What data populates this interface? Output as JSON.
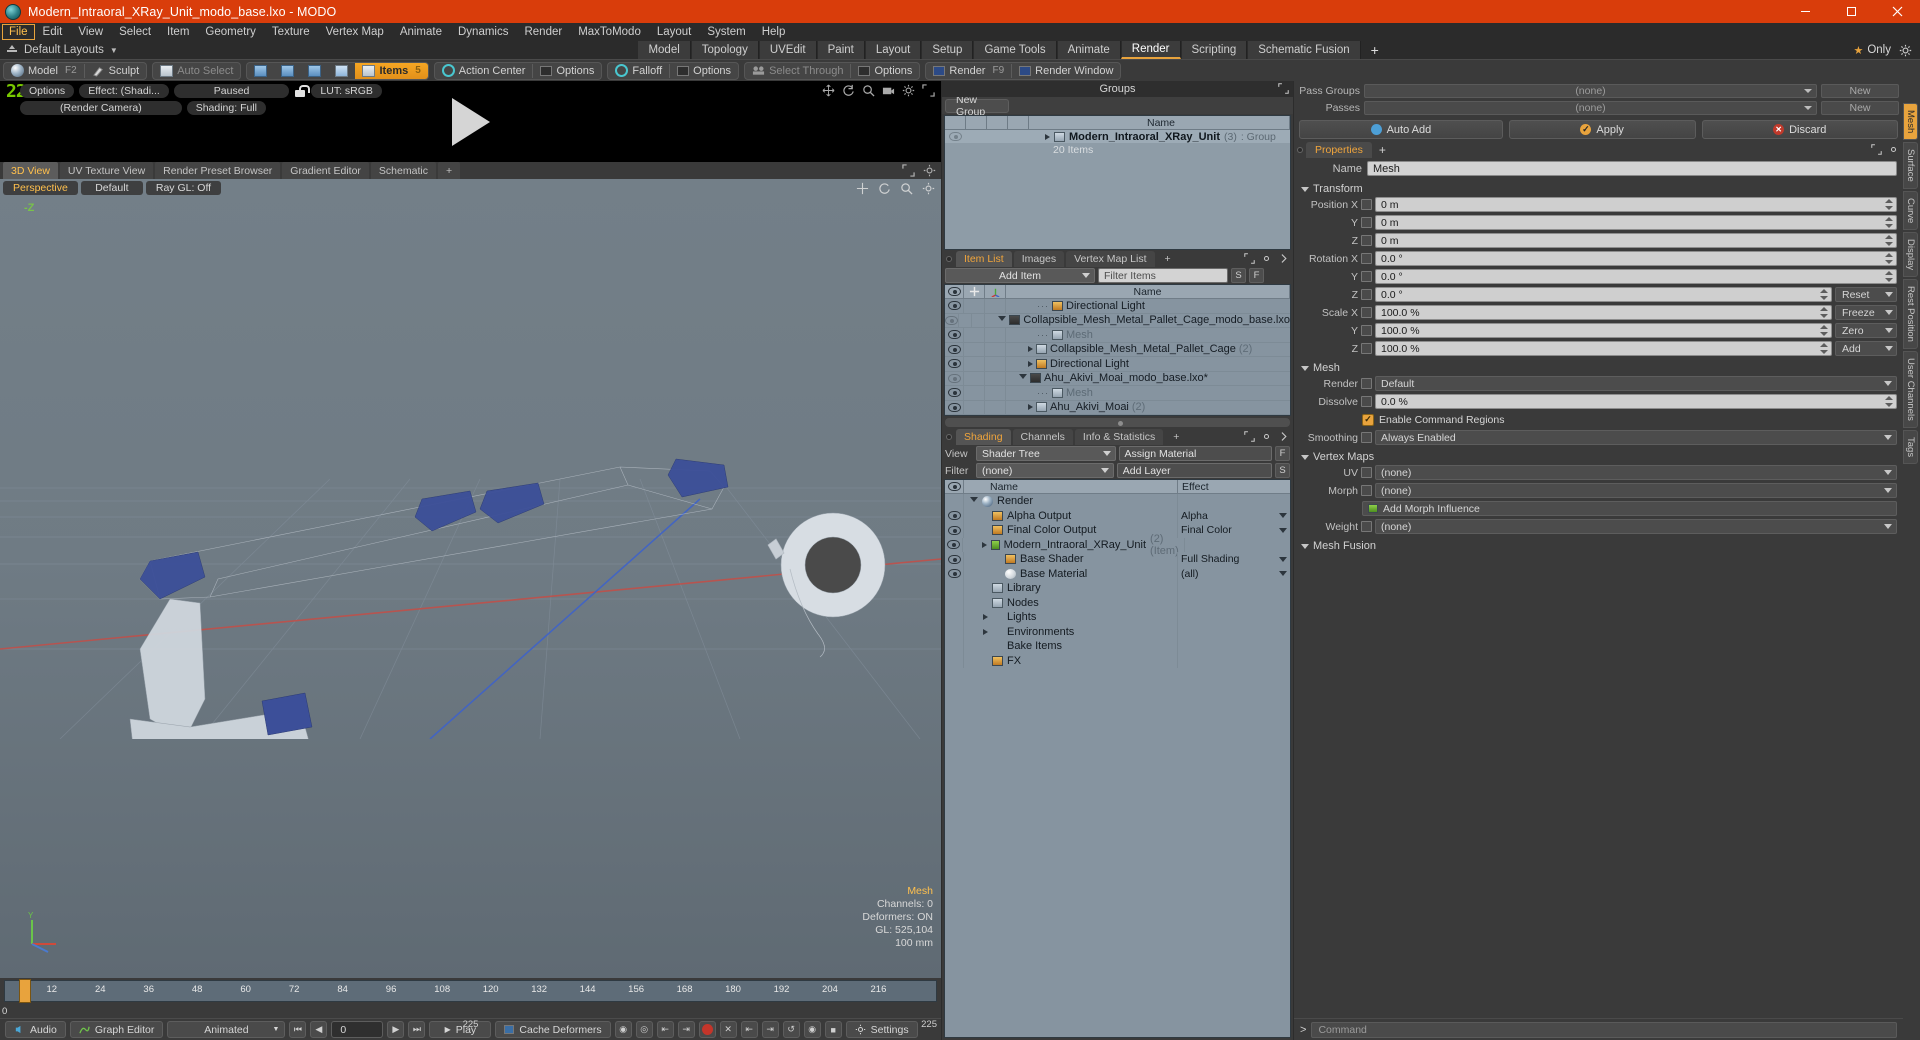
{
  "window": {
    "title": "Modern_Intraoral_XRay_Unit_modo_base.lxo - MODO",
    "minimize": "–",
    "maximize": "❐",
    "close": "✕"
  },
  "menus": [
    "File",
    "Edit",
    "View",
    "Select",
    "Item",
    "Geometry",
    "Texture",
    "Vertex Map",
    "Animate",
    "Dynamics",
    "Render",
    "MaxToModo",
    "Layout",
    "System",
    "Help"
  ],
  "active_menu": "File",
  "layout_bar": {
    "layouts_label": "Default Layouts",
    "tabs": [
      "Model",
      "Topology",
      "UVEdit",
      "Paint",
      "Layout",
      "Setup",
      "Game Tools",
      "Animate",
      "Render",
      "Scripting",
      "Schematic Fusion"
    ],
    "selected_tab": "Render",
    "plus": "+",
    "only_label": "Only",
    "star": "★"
  },
  "mode_toolbar": {
    "model": "Model",
    "model_key": "F2",
    "sculpt": "Sculpt",
    "auto_select": "Auto Select",
    "items": "Items",
    "items_key": "5",
    "action_center": "Action Center",
    "options1": "Options",
    "falloff": "Falloff",
    "options2": "Options",
    "select_through": "Select Through",
    "options3": "Options",
    "render": "Render",
    "render_key": "F9",
    "render_window": "Render Window"
  },
  "render_preview": {
    "badge": "22",
    "options": "Options",
    "effect": "Effect: (Shadi...",
    "status": "Paused",
    "lut": "LUT: sRGB",
    "camera": "(Render Camera)",
    "shading": "Shading: Full"
  },
  "viewport_tabs": {
    "tabs": [
      "3D View",
      "UV Texture View",
      "Render Preset Browser",
      "Gradient Editor",
      "Schematic"
    ],
    "selected": "3D View",
    "plus": "+"
  },
  "viewport": {
    "projection": "Perspective",
    "style": "Default",
    "raygl": "Ray GL: Off",
    "axis_label": "-Z",
    "stats": {
      "title": "Mesh",
      "channels": "Channels: 0",
      "deformers": "Deformers: ON",
      "gl": "GL: 525,104",
      "scale": "100 mm"
    }
  },
  "timeline": {
    "ticks": [
      "12",
      "24",
      "36",
      "48",
      "60",
      "72",
      "84",
      "96",
      "108",
      "120",
      "132",
      "144",
      "156",
      "168",
      "180",
      "192",
      "204",
      "216"
    ],
    "start": "0",
    "center": "225",
    "end": "225"
  },
  "bottom_bar": {
    "audio": "Audio",
    "graph_editor": "Graph Editor",
    "animated": "Animated",
    "frame": "0",
    "play": "Play",
    "cache_deformers": "Cache Deformers",
    "settings": "Settings"
  },
  "groups_panel": {
    "title": "Groups",
    "new_group": "New Group",
    "columns": [
      "Name"
    ],
    "rows": [
      {
        "name": "Modern_Intraoral_XRay_Unit",
        "count": "(3)",
        "type": ": Group",
        "sub": "20 Items"
      }
    ]
  },
  "item_list": {
    "tabs": [
      "Item List",
      "Images",
      "Vertex Map List"
    ],
    "selected_tab": "Item List",
    "plus": "+",
    "add_item": "Add Item",
    "filter_placeholder": "Filter Items",
    "btn_s": "S",
    "btn_f": "F",
    "columns": [
      "Name"
    ],
    "rows": [
      {
        "name": "Directional Light",
        "suffix": "",
        "indent": 3,
        "icon": "light-icon",
        "expander": "",
        "visible": true,
        "gray": false
      },
      {
        "name": "Collapsible_Mesh_Metal_Pallet_Cage_modo_base.lxo",
        "suffix": "",
        "indent": 1,
        "icon": "scene-icon",
        "expander": "down",
        "visible": false,
        "gray": false
      },
      {
        "name": "Mesh",
        "suffix": "",
        "indent": 3,
        "icon": "mesh-icon",
        "expander": "",
        "visible": true,
        "gray": true
      },
      {
        "name": "Collapsible_Mesh_Metal_Pallet_Cage",
        "suffix": "(2)",
        "indent": 2,
        "icon": "group-icon",
        "expander": "right",
        "visible": true,
        "gray": false
      },
      {
        "name": "Directional Light",
        "suffix": "",
        "indent": 2,
        "icon": "light-icon",
        "expander": "right",
        "visible": true,
        "gray": false
      },
      {
        "name": "Ahu_Akivi_Moai_modo_base.lxo*",
        "suffix": "",
        "indent": 1,
        "icon": "scene-icon",
        "expander": "down",
        "visible": false,
        "gray": false
      },
      {
        "name": "Mesh",
        "suffix": "",
        "indent": 3,
        "icon": "mesh-icon",
        "expander": "",
        "visible": true,
        "gray": true
      },
      {
        "name": "Ahu_Akivi_Moai",
        "suffix": "(2)",
        "indent": 2,
        "icon": "group-icon",
        "expander": "right",
        "visible": true,
        "gray": false
      }
    ]
  },
  "shading_panel": {
    "tabs": [
      "Shading",
      "Channels",
      "Info & Statistics"
    ],
    "selected_tab": "Shading",
    "plus": "+",
    "view_label": "View",
    "view_value": "Shader Tree",
    "filter_label": "Filter",
    "filter_value": "(none)",
    "assign_material": "Assign Material",
    "add_layer": "Add Layer",
    "btn_f": "F",
    "btn_s": "S",
    "columns": {
      "name": "Name",
      "effect": "Effect"
    },
    "rows": [
      {
        "name": "Render",
        "extra": "",
        "effect": "",
        "icon": "sphere-icon",
        "expander": "down",
        "indent": 0,
        "eye": false
      },
      {
        "name": "Alpha Output",
        "extra": "",
        "effect": "Alpha",
        "icon": "image-icon",
        "expander": "",
        "indent": 1,
        "eye": true
      },
      {
        "name": "Final Color Output",
        "extra": "",
        "effect": "Final Color",
        "icon": "image-icon",
        "expander": "",
        "indent": 1,
        "eye": true
      },
      {
        "name": "Modern_Intraoral_XRay_Unit",
        "extra": "(2) (Item)",
        "effect": "",
        "icon": "material-icon",
        "expander": "right",
        "indent": 1,
        "eye": true
      },
      {
        "name": "Base Shader",
        "extra": "",
        "effect": "Full Shading",
        "icon": "shader-icon",
        "expander": "",
        "indent": 2,
        "eye": true
      },
      {
        "name": "Base Material",
        "extra": "",
        "effect": "(all)",
        "icon": "material-ball-icon",
        "expander": "",
        "indent": 2,
        "eye": true
      },
      {
        "name": "Library",
        "extra": "",
        "effect": "",
        "icon": "folder-icon",
        "expander": "",
        "indent": 1,
        "eye": false
      },
      {
        "name": "Nodes",
        "extra": "",
        "effect": "",
        "icon": "folder-icon",
        "expander": "",
        "indent": 1,
        "eye": false
      },
      {
        "name": "Lights",
        "extra": "",
        "effect": "",
        "icon": "",
        "expander": "right",
        "indent": 1,
        "eye": false
      },
      {
        "name": "Environments",
        "extra": "",
        "effect": "",
        "icon": "",
        "expander": "right",
        "indent": 1,
        "eye": false
      },
      {
        "name": "Bake Items",
        "extra": "",
        "effect": "",
        "icon": "",
        "expander": "",
        "indent": 1,
        "eye": false
      },
      {
        "name": "FX",
        "extra": "",
        "effect": "",
        "icon": "fx-icon",
        "expander": "",
        "indent": 1,
        "eye": false
      }
    ]
  },
  "properties": {
    "pass_groups_label": "Pass Groups",
    "pass_groups_value": "(none)",
    "passes_label": "Passes",
    "passes_value": "(none)",
    "new_button": "New",
    "new_button2": "New",
    "auto_add": "Auto Add",
    "apply": "Apply",
    "discard": "Discard",
    "tab_label": "Properties",
    "plus": "+",
    "name_label": "Name",
    "name_value": "Mesh",
    "sections": {
      "transform": {
        "title": "Transform",
        "rows": [
          {
            "label": "Position X",
            "value": "0 m"
          },
          {
            "label": "Y",
            "value": "0 m"
          },
          {
            "label": "Z",
            "value": "0 m"
          },
          {
            "label": "Rotation X",
            "value": "0.0 °"
          },
          {
            "label": "Y",
            "value": "0.0 °"
          },
          {
            "label": "Z",
            "value": "0.0 °"
          },
          {
            "label": "Scale X",
            "value": "100.0 %"
          },
          {
            "label": "Y",
            "value": "100.0 %"
          },
          {
            "label": "Z",
            "value": "100.0 %"
          }
        ],
        "buttons": [
          "Reset",
          "Freeze",
          "Zero",
          "Add"
        ]
      },
      "mesh": {
        "title": "Mesh",
        "render_label": "Render",
        "render_value": "Default",
        "dissolve_label": "Dissolve",
        "dissolve_value": "0.0 %",
        "command_regions": "Enable Command Regions",
        "smoothing_label": "Smoothing",
        "smoothing_value": "Always Enabled"
      },
      "vertex_maps": {
        "title": "Vertex Maps",
        "rows": [
          {
            "label": "UV",
            "value": "(none)"
          },
          {
            "label": "Morph",
            "value": "(none)"
          },
          {
            "label": "Weight",
            "value": "(none)"
          }
        ],
        "morph_influence": "Add Morph Influence"
      },
      "mesh_fusion": {
        "title": "Mesh Fusion"
      }
    },
    "side_tabs": [
      "Mesh",
      "Surface",
      "Curve",
      "Display",
      "Rest Position",
      "User Channels",
      "Tags"
    ],
    "side_selected": "Mesh"
  },
  "command_bar": {
    "prompt": ">",
    "placeholder": "Command"
  }
}
